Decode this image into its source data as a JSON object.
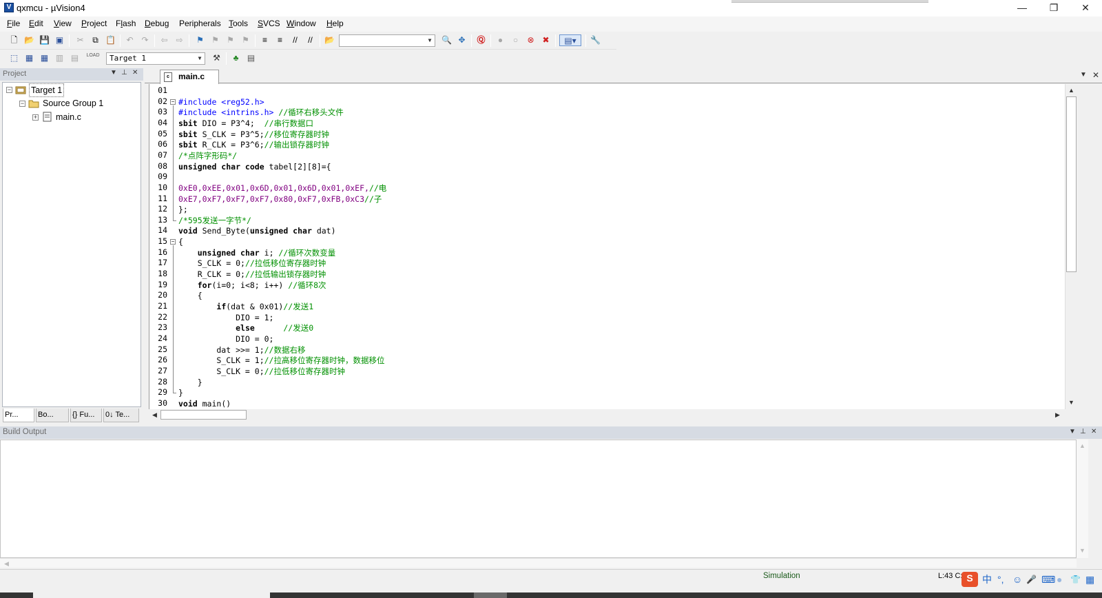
{
  "window": {
    "icon_letter": "V",
    "title": "qxmcu - µVision4",
    "minimize": "—",
    "restore": "❐",
    "close": "✕"
  },
  "menu": [
    {
      "label": "File",
      "mnemonic": "F"
    },
    {
      "label": "Edit",
      "mnemonic": "E"
    },
    {
      "label": "View",
      "mnemonic": "V"
    },
    {
      "label": "Project",
      "mnemonic": "P"
    },
    {
      "label": "Flash",
      "mnemonic": "l"
    },
    {
      "label": "Debug",
      "mnemonic": "D"
    },
    {
      "label": "Peripherals",
      "mnemonic": "k"
    },
    {
      "label": "Tools",
      "mnemonic": "T"
    },
    {
      "label": "SVCS",
      "mnemonic": "S"
    },
    {
      "label": "Window",
      "mnemonic": "W"
    },
    {
      "label": "Help",
      "mnemonic": "H"
    }
  ],
  "toolbar": {
    "search_combo_value": "",
    "target_combo_value": "Target 1",
    "load_label": "LOAD"
  },
  "project_panel": {
    "title": "Project",
    "tree": {
      "target": "Target 1",
      "group": "Source Group 1",
      "file": "main.c"
    },
    "tabs": [
      {
        "label": "Pr..."
      },
      {
        "label": "Bo..."
      },
      {
        "label": "{} Fu..."
      },
      {
        "label": "0↓ Te..."
      }
    ]
  },
  "editor": {
    "tab_label": "main.c",
    "tab_icon_text": "c",
    "lines": [
      {
        "num": "01",
        "segments": []
      },
      {
        "num": "02",
        "segments": [
          {
            "t": "#include <reg52.h>",
            "c": "pp"
          }
        ]
      },
      {
        "num": "03",
        "segments": [
          {
            "t": "#include <intrins.h>",
            "c": "pp"
          },
          {
            "t": " //循环右移头文件",
            "c": "cm"
          }
        ]
      },
      {
        "num": "04",
        "segments": [
          {
            "t": "sbit",
            "c": "kw"
          },
          {
            "t": " DIO = P3^4;  ",
            "c": "plain"
          },
          {
            "t": "//串行数据口",
            "c": "cm"
          }
        ]
      },
      {
        "num": "05",
        "segments": [
          {
            "t": "sbit",
            "c": "kw"
          },
          {
            "t": " S_CLK = P3^5;",
            "c": "plain"
          },
          {
            "t": "//移位寄存器时钟",
            "c": "cm"
          }
        ]
      },
      {
        "num": "06",
        "segments": [
          {
            "t": "sbit",
            "c": "kw"
          },
          {
            "t": " R_CLK = P3^6;",
            "c": "plain"
          },
          {
            "t": "//输出锁存器时钟",
            "c": "cm"
          }
        ]
      },
      {
        "num": "07",
        "segments": [
          {
            "t": "/*点阵字形码*/",
            "c": "cm"
          }
        ]
      },
      {
        "num": "08",
        "segments": [
          {
            "t": "unsigned char code",
            "c": "kw"
          },
          {
            "t": " tabel[2][8]={",
            "c": "plain"
          }
        ]
      },
      {
        "num": "09",
        "segments": []
      },
      {
        "num": "10",
        "segments": [
          {
            "t": "0xE0,0xEE,0x01,0x6D,0x01,0x6D,0x01,0xEF,",
            "c": "num"
          },
          {
            "t": "//电",
            "c": "cm"
          }
        ]
      },
      {
        "num": "11",
        "segments": [
          {
            "t": "0xE7,0xF7,0xF7,0xF7,0x80,0xF7,0xFB,0xC3",
            "c": "num"
          },
          {
            "t": "//子",
            "c": "cm"
          }
        ]
      },
      {
        "num": "12",
        "segments": [
          {
            "t": "};",
            "c": "plain"
          }
        ]
      },
      {
        "num": "13",
        "segments": [
          {
            "t": "/*595发送一字节*/",
            "c": "cm"
          }
        ]
      },
      {
        "num": "14",
        "segments": [
          {
            "t": "void",
            "c": "kw"
          },
          {
            "t": " Send_Byte(",
            "c": "plain"
          },
          {
            "t": "unsigned char",
            "c": "kw"
          },
          {
            "t": " dat)",
            "c": "plain"
          }
        ]
      },
      {
        "num": "15",
        "segments": [
          {
            "t": "{",
            "c": "plain"
          }
        ]
      },
      {
        "num": "16",
        "segments": [
          {
            "t": "    ",
            "c": "plain"
          },
          {
            "t": "unsigned char",
            "c": "kw"
          },
          {
            "t": " i; ",
            "c": "plain"
          },
          {
            "t": "//循环次数变量",
            "c": "cm"
          }
        ]
      },
      {
        "num": "17",
        "segments": [
          {
            "t": "    S_CLK = 0;",
            "c": "plain"
          },
          {
            "t": "//拉低移位寄存器时钟",
            "c": "cm"
          }
        ]
      },
      {
        "num": "18",
        "segments": [
          {
            "t": "    R_CLK = 0;",
            "c": "plain"
          },
          {
            "t": "//拉低输出锁存器时钟",
            "c": "cm"
          }
        ]
      },
      {
        "num": "19",
        "segments": [
          {
            "t": "    ",
            "c": "plain"
          },
          {
            "t": "for",
            "c": "kw"
          },
          {
            "t": "(i=0; i<8; i++) ",
            "c": "plain"
          },
          {
            "t": "//循环8次",
            "c": "cm"
          }
        ]
      },
      {
        "num": "20",
        "segments": [
          {
            "t": "    {",
            "c": "plain"
          }
        ]
      },
      {
        "num": "21",
        "segments": [
          {
            "t": "        ",
            "c": "plain"
          },
          {
            "t": "if",
            "c": "kw"
          },
          {
            "t": "(dat & 0x01)",
            "c": "plain"
          },
          {
            "t": "//发送1",
            "c": "cm"
          }
        ]
      },
      {
        "num": "22",
        "segments": [
          {
            "t": "            DIO = 1;",
            "c": "plain"
          }
        ]
      },
      {
        "num": "23",
        "segments": [
          {
            "t": "            ",
            "c": "plain"
          },
          {
            "t": "else",
            "c": "kw"
          },
          {
            "t": "      ",
            "c": "plain"
          },
          {
            "t": "//发送0",
            "c": "cm"
          }
        ]
      },
      {
        "num": "24",
        "segments": [
          {
            "t": "            DIO = 0;",
            "c": "plain"
          }
        ]
      },
      {
        "num": "25",
        "segments": [
          {
            "t": "        dat >>= 1;",
            "c": "plain"
          },
          {
            "t": "//数据右移",
            "c": "cm"
          }
        ]
      },
      {
        "num": "26",
        "segments": [
          {
            "t": "        S_CLK = 1;",
            "c": "plain"
          },
          {
            "t": "//拉高移位寄存器时钟，数据移位",
            "c": "cm"
          }
        ]
      },
      {
        "num": "27",
        "segments": [
          {
            "t": "        S_CLK = 0;",
            "c": "plain"
          },
          {
            "t": "//拉低移位寄存器时钟",
            "c": "cm"
          }
        ]
      },
      {
        "num": "28",
        "segments": [
          {
            "t": "    }",
            "c": "plain"
          }
        ]
      },
      {
        "num": "29",
        "segments": [
          {
            "t": "}",
            "c": "plain"
          }
        ]
      },
      {
        "num": "30",
        "segments": [
          {
            "t": "void",
            "c": "kw"
          },
          {
            "t": " main()",
            "c": "plain"
          }
        ]
      }
    ]
  },
  "build_output": {
    "title": "Build Output"
  },
  "status": {
    "mode": "Simulation",
    "position": "L:43 C:"
  },
  "ime": {
    "logo": "S",
    "lang": "中",
    "punct": "°,",
    "emoji": "☺",
    "mic": "🎤",
    "keyboard": "⌨",
    "skin": "👕",
    "grid": "▦"
  },
  "colors": {
    "keyword": "#000000",
    "preprocessor": "#0000ff",
    "number": "#800080",
    "comment": "#009000",
    "panel_header": "#d6dbe3",
    "status_simulation": "#1a5a1a"
  }
}
